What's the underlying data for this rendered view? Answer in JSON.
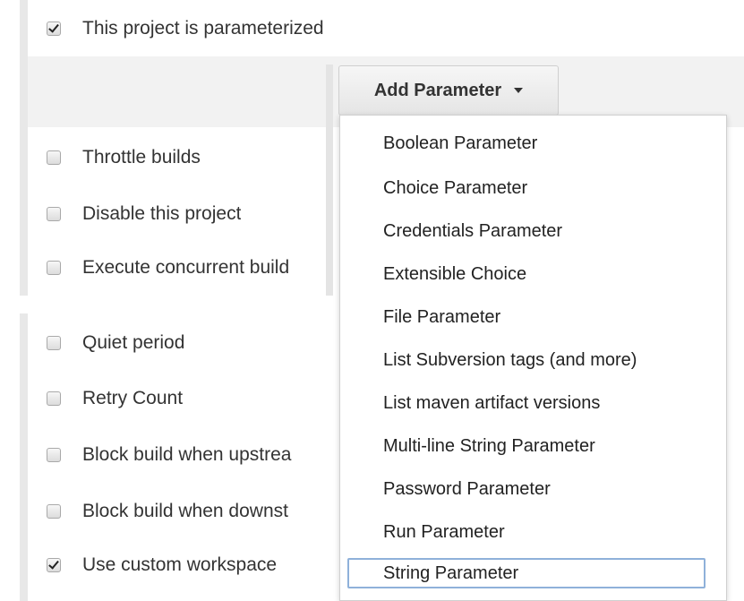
{
  "parameterized": {
    "label": "This project is parameterized",
    "checked": true
  },
  "add_parameter": {
    "label": "Add Parameter"
  },
  "options_top": [
    {
      "label": "Throttle builds",
      "checked": false
    },
    {
      "label": "Disable this project",
      "checked": false
    },
    {
      "label": "Execute concurrent build",
      "checked": false
    }
  ],
  "options_bottom": [
    {
      "label": "Quiet period",
      "checked": false
    },
    {
      "label": "Retry Count",
      "checked": false
    },
    {
      "label": "Block build when upstrea",
      "checked": false
    },
    {
      "label": "Block build when downst",
      "checked": false
    },
    {
      "label": "Use custom workspace",
      "checked": true
    }
  ],
  "menu": {
    "items": [
      "Boolean Parameter",
      "Choice Parameter",
      "Credentials Parameter",
      "Extensible Choice",
      "File Parameter",
      "List Subversion tags (and more)",
      "List maven artifact versions",
      "Multi-line String Parameter",
      "Password Parameter",
      "Run Parameter",
      "String Parameter"
    ],
    "focused_item": "String Parameter"
  }
}
